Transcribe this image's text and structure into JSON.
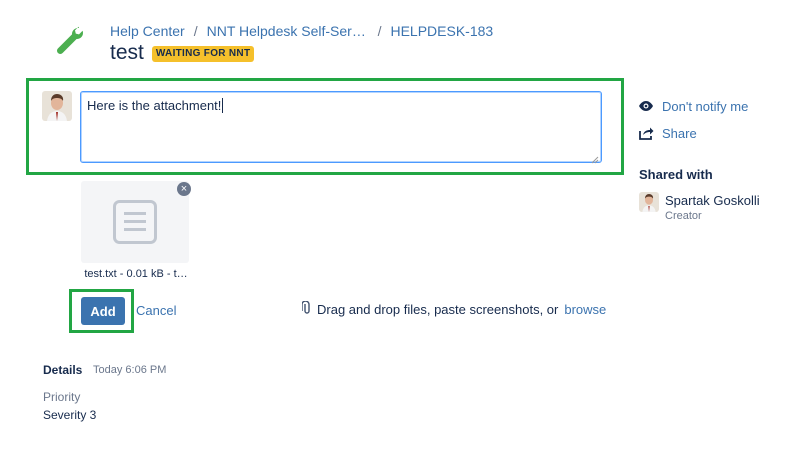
{
  "header": {
    "breadcrumb": [
      "Help Center",
      "NNT Helpdesk Self-Servic…",
      "HELPDESK-183"
    ],
    "breadcrumb_separator": "/",
    "title": "test",
    "status": "WAITING FOR NNT",
    "status_color": "#f5c02b",
    "project_icon": "wrench-icon"
  },
  "comment": {
    "value": "Here is the attachment!",
    "highlight_color": "#22a644"
  },
  "attachment": {
    "name": "test.txt - 0.01 kB - t…",
    "remove_label": "×",
    "icon": "text-file-icon"
  },
  "actions": {
    "add_label": "Add",
    "cancel_label": "Cancel",
    "dropzone_text": "Drag and drop files, paste screenshots, or",
    "browse_label": "browse"
  },
  "details": {
    "label": "Details",
    "time": "Today 6:06 PM",
    "priority_label": "Priority",
    "priority_value": "Severity 3"
  },
  "sidebar": {
    "notify_label": "Don't notify me",
    "share_label": "Share",
    "shared_with_heading": "Shared with",
    "participants": [
      {
        "name": "Spartak Goskolli",
        "role": "Creator"
      }
    ]
  },
  "colors": {
    "link": "#3b73af",
    "primary_button": "#3b73af"
  }
}
